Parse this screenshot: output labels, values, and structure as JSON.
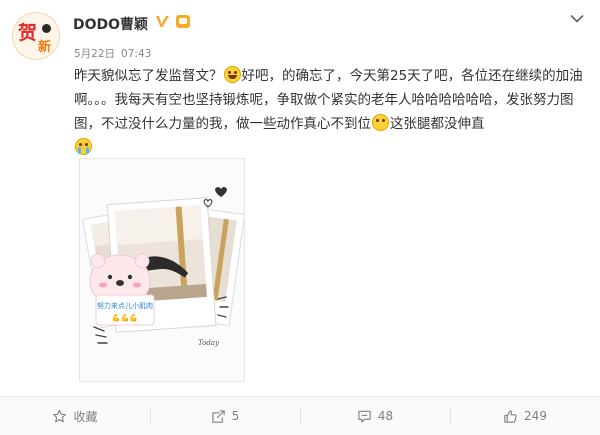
{
  "post": {
    "author": "DODO曹颖",
    "date": "5月22日",
    "time": "07:43",
    "text_parts": [
      "昨天貌似忘了发监督文？",
      "好吧，的确忘了，今天第25天了吧，各位还在继续的加油啊。。。我每天有空也坚持锻炼呢，争取做个紧实的老年人哈哈哈哈哈哈，发张努力图图，不过没什么力量的我，做一些动作真心不到位",
      "这张腿都没伸直"
    ],
    "emojis": [
      "laughing-emoji",
      "cheeky-emoji",
      "crying-emoji"
    ],
    "avatar_text": [
      "贺",
      "新"
    ],
    "photo": {
      "sticker_text": "努力来点儿小肌肉",
      "sticker_emoji": "💪💪💪",
      "signature": "Today"
    }
  },
  "actions": [
    {
      "label": "收藏",
      "icon": "star-icon"
    },
    {
      "label": "5",
      "icon": "repost-icon"
    },
    {
      "label": "48",
      "icon": "comment-icon"
    },
    {
      "label": "249",
      "icon": "like-icon"
    }
  ],
  "colors": {
    "text": "#333333",
    "meta": "#888888",
    "verified": "#f7a928",
    "footer_bg": "#fafafa"
  }
}
